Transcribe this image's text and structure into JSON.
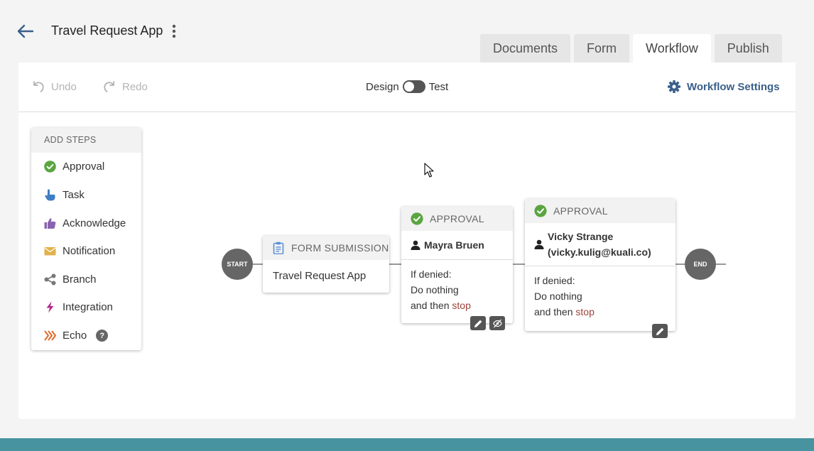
{
  "header": {
    "title": "Travel Request App",
    "tabs": [
      {
        "label": "Documents"
      },
      {
        "label": "Form"
      },
      {
        "label": "Workflow"
      },
      {
        "label": "Publish"
      }
    ]
  },
  "toolbar": {
    "undo_label": "Undo",
    "redo_label": "Redo",
    "mode_left": "Design",
    "mode_right": "Test",
    "settings_label": "Workflow Settings"
  },
  "steps_panel": {
    "title": "ADD STEPS",
    "items": [
      {
        "label": "Approval",
        "icon": "check-circle-icon",
        "color": "#5aa541"
      },
      {
        "label": "Task",
        "icon": "hand-pointer-icon",
        "color": "#3d7ec4"
      },
      {
        "label": "Acknowledge",
        "icon": "thumbs-up-icon",
        "color": "#8a63b0"
      },
      {
        "label": "Notification",
        "icon": "envelope-icon",
        "color": "#e0b24a"
      },
      {
        "label": "Branch",
        "icon": "share-icon",
        "color": "#777777"
      },
      {
        "label": "Integration",
        "icon": "bolt-icon",
        "color": "#b7288b"
      },
      {
        "label": "Echo",
        "icon": "chevrons-icon",
        "color": "#e0692a",
        "help": "?"
      }
    ]
  },
  "workflow": {
    "start_label": "START",
    "end_label": "END",
    "form_submission": {
      "header": "FORM SUBMISSION",
      "body": "Travel Request App"
    },
    "approval_1": {
      "header": "APPROVAL",
      "approver": "Mayra Bruen",
      "denied_line1": "If denied:",
      "denied_line2": "Do nothing",
      "denied_line3": "and then",
      "denied_action": "stop"
    },
    "approval_2": {
      "header": "APPROVAL",
      "approver_line1": "Vicky Strange",
      "approver_line2": "(vicky.kulig@kuali.co)",
      "denied_line1": "If denied:",
      "denied_line2": "Do nothing",
      "denied_line3": "and then",
      "denied_action": "stop"
    }
  },
  "colors": {
    "accent": "#3a5f8a",
    "approval_green": "#5aa541",
    "stop_red": "#a0433a",
    "footer_teal": "#47939f"
  }
}
